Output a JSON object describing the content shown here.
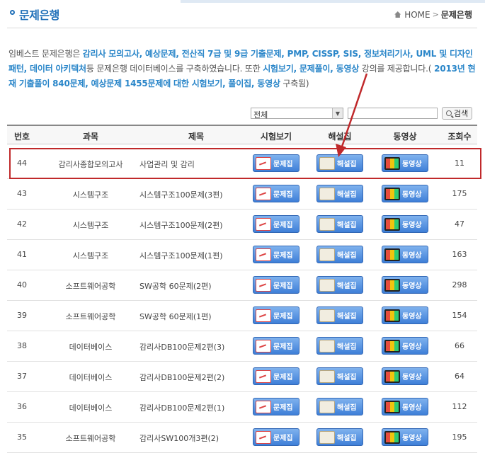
{
  "header": {
    "title": "문제은행",
    "breadcrumb_home": "HOME",
    "breadcrumb_sep": ">",
    "breadcrumb_current": "문제은행"
  },
  "intro": {
    "p1": "임베스트 문제은행은 ",
    "h1": "감리사 모의고사, 예상문제, 전산직 7급 및 9급 기출문제, PMP, CISSP, SIS, 정보처리기사, UML 및 디자인패턴, 데이터 아키텍처",
    "p2": "등 문제은행 데이터베이스를 구축하였습니다. 또한 ",
    "h2": "시험보기, 문제풀이, 동영상",
    "p3": " 강의를 제공합니다.(",
    "h3": " 2013년 현재 기출풀이 840문제, 예상문제 1455문제에 대한 시험보기, 풀이집, 동영상",
    "p4": " 구축됨)"
  },
  "search": {
    "category_value": "전체",
    "input_value": "",
    "button_label": "검색"
  },
  "table": {
    "headers": [
      "번호",
      "과목",
      "제목",
      "시험보기",
      "해설집",
      "동영상",
      "조회수"
    ],
    "rows": [
      {
        "num": "44",
        "subject": "감리사종합모의고사",
        "title": "사업관리 및 감리",
        "views": "11"
      },
      {
        "num": "43",
        "subject": "시스템구조",
        "title": "시스템구조100문제(3편)",
        "views": "175"
      },
      {
        "num": "42",
        "subject": "시스템구조",
        "title": "시스템구조100문제(2편)",
        "views": "47"
      },
      {
        "num": "41",
        "subject": "시스템구조",
        "title": "시스템구조100문제(1편)",
        "views": "163"
      },
      {
        "num": "40",
        "subject": "소프트웨어공학",
        "title": "SW공학 60문제(2편)",
        "views": "298"
      },
      {
        "num": "39",
        "subject": "소프트웨어공학",
        "title": "SW공학 60문제(1편)",
        "views": "154"
      },
      {
        "num": "38",
        "subject": "데이터베이스",
        "title": "감리사DB100문제2편(3)",
        "views": "66"
      },
      {
        "num": "37",
        "subject": "데이터베이스",
        "title": "감리사DB100문제2편(2)",
        "views": "64"
      },
      {
        "num": "36",
        "subject": "데이터베이스",
        "title": "감리사DB100문제2편(1)",
        "views": "112"
      },
      {
        "num": "35",
        "subject": "소프트웨어공학",
        "title": "감리사SW100개3편(2)",
        "views": "195"
      }
    ]
  },
  "buttons": {
    "exam": "문제집",
    "solution": "해설집",
    "video": "동영상"
  },
  "icons": {
    "exam": "exam-paper-icon",
    "solution": "open-book-icon",
    "video": "tv-screen-icon"
  },
  "colors": {
    "accent": "#1f6fb8",
    "highlight_text": "#2a86c9",
    "button": "#3e7fd8",
    "annotation": "#c0292b"
  }
}
